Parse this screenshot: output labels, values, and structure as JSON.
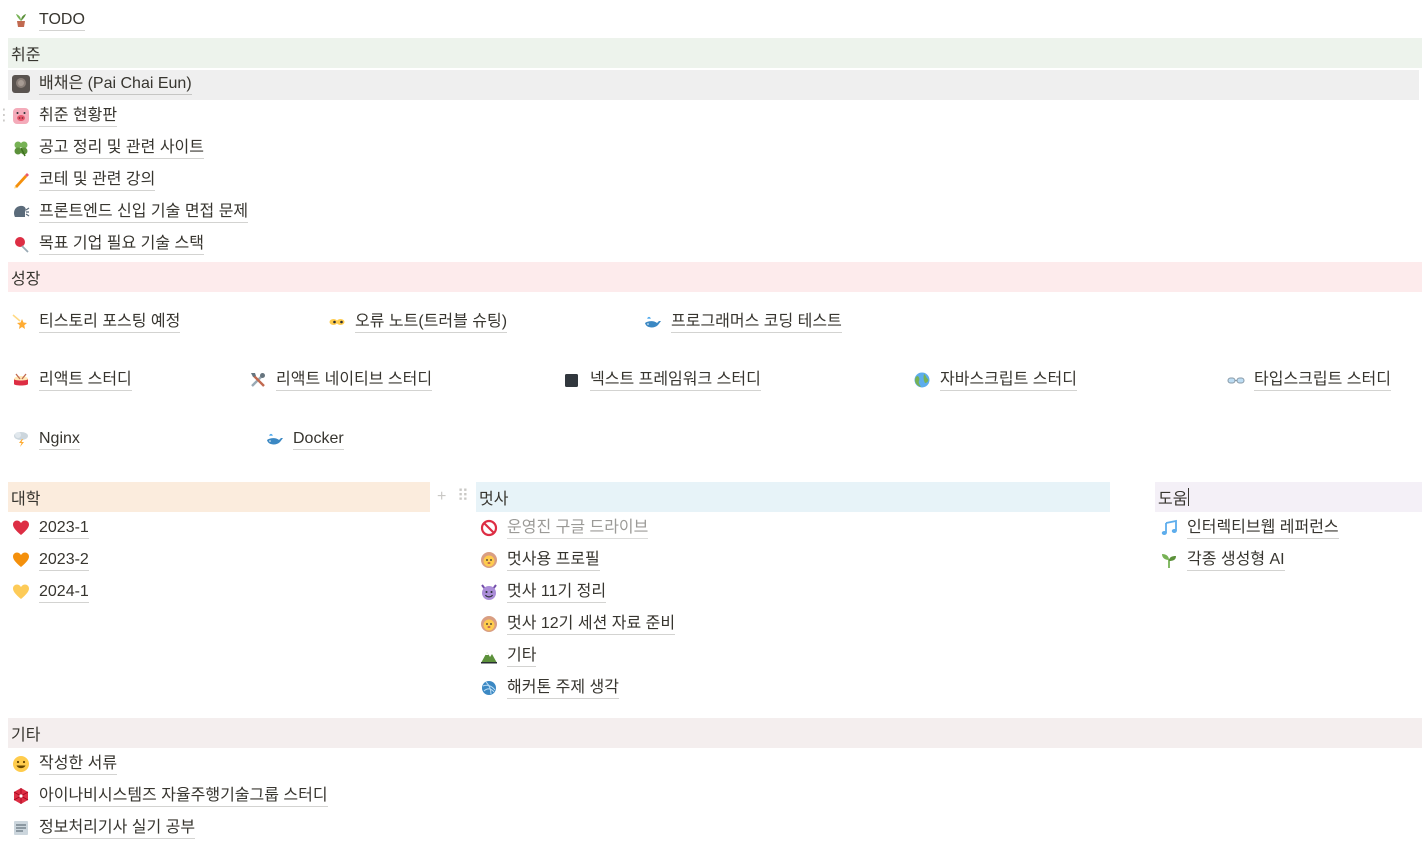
{
  "todo": {
    "label": "TODO",
    "icon": "potted-plant-icon"
  },
  "sections": {
    "job": {
      "title": "취준",
      "color": "#edf3ec",
      "items": [
        {
          "label": "배채은 (Pai Chai Eun)",
          "icon": "profile-photo-icon"
        },
        {
          "label": "취준 현황판",
          "icon": "pig-face-icon"
        },
        {
          "label": "공고 정리 및 관련 사이트",
          "icon": "four-leaf-clover-icon"
        },
        {
          "label": "코테 및 관련 강의",
          "icon": "pencil-icon"
        },
        {
          "label": "프론트엔드 신입 기술 면접 문제",
          "icon": "speaking-head-icon"
        },
        {
          "label": "목표 기업 필요 기술 스택",
          "icon": "pushpin-icon"
        }
      ]
    },
    "growth": {
      "title": "성장",
      "color": "#fdebec",
      "items": [
        {
          "label": "티스토리 포스팅 예정",
          "icon": "shooting-star-icon"
        },
        {
          "label": "오류 노트(트러블 슈팅)",
          "icon": "eyes-icon"
        },
        {
          "label": "프로그래머스 코딩 테스트",
          "icon": "whale-icon"
        },
        {
          "label": "리액트 스터디",
          "icon": "drum-icon"
        },
        {
          "label": "리액트 네이티브 스터디",
          "icon": "tools-icon"
        },
        {
          "label": "넥스트 프레임워크 스터디",
          "icon": "black-square-icon"
        },
        {
          "label": "자바스크립트 스터디",
          "icon": "globe-icon"
        },
        {
          "label": "타입스크립트 스터디",
          "icon": "goggles-icon"
        },
        {
          "label": "Nginx",
          "icon": "lightning-cloud-icon"
        },
        {
          "label": "Docker",
          "icon": "whale-icon"
        }
      ]
    },
    "univ": {
      "title": "대학",
      "color": "#fbecdd",
      "items": [
        {
          "label": "2023-1",
          "icon": "red-heart-icon"
        },
        {
          "label": "2023-2",
          "icon": "orange-heart-icon"
        },
        {
          "label": "2024-1",
          "icon": "yellow-heart-icon"
        }
      ]
    },
    "likelion": {
      "title": "멋사",
      "color": "#e7f3f8",
      "items": [
        {
          "label": "운영진 구글 드라이브",
          "icon": "prohibited-icon",
          "muted": true
        },
        {
          "label": "멋사용 프로필",
          "icon": "lion-face-icon"
        },
        {
          "label": "멋사 11기 정리",
          "icon": "smiling-devil-icon"
        },
        {
          "label": "멋사 12기 세션 자료 준비",
          "icon": "lion-face-icon"
        },
        {
          "label": "기타",
          "icon": "mountain-icon"
        },
        {
          "label": "해커톤 주제 생각",
          "icon": "yarn-ball-icon"
        }
      ]
    },
    "help": {
      "title": "도움",
      "color": "#f4f0f7",
      "items": [
        {
          "label": "인터렉티브웹 레퍼런스",
          "icon": "music-note-icon"
        },
        {
          "label": "각종 생성형 AI",
          "icon": "seedling-icon"
        }
      ]
    },
    "etc": {
      "title": "기타",
      "color": "#f4eeee",
      "items": [
        {
          "label": "작성한 서류",
          "icon": "smiling-face-icon"
        },
        {
          "label": "아이나비시스템즈 자율주행기술그룹 스터디",
          "icon": "red-gem-icon"
        },
        {
          "label": "정보처리기사 실기 공부",
          "icon": "document-icon"
        }
      ]
    }
  }
}
